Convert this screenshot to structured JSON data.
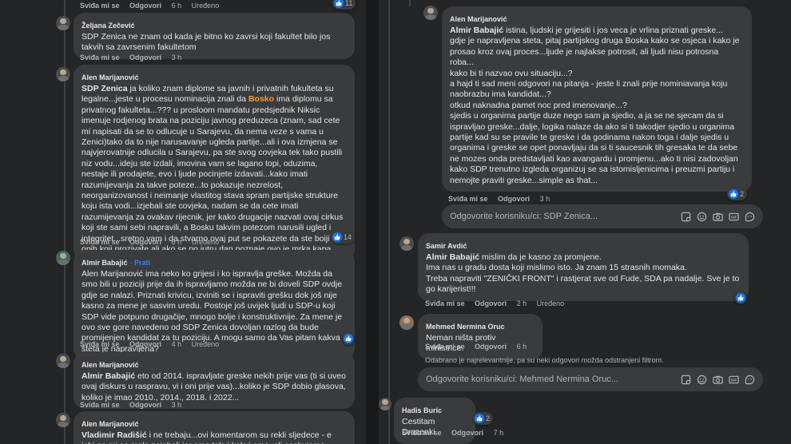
{
  "left": {
    "top_actions": {
      "like": "Sviđa mi se",
      "reply": "Odgovori",
      "time": "6 h",
      "edited": "Uređeno",
      "reactions": "11"
    },
    "comments": [
      {
        "author": "Željana Zečević",
        "text": "SDP Zenica ne znam od kada je bitno ko zavrsi koji fakultet bilo jos takvih sa zavrsenim fakultetom",
        "like": "Sviđa mi se",
        "reply": "Odgovori",
        "time": "3 h"
      },
      {
        "author": "Alen Marijanović",
        "mention": "SDP Zenica",
        "text_a": " ja koliko znam diplome sa javnih i privatnih fukulteta su legalne...jeste u procesu nominacija znali da ",
        "highlight": "Bosko",
        "text_b": " ima diplomu sa privatnog fakulteta...??? u prosloom mandatu predsjednik Niksic imenuje rodjenog brata na poziciju javnog preduzeca (znam, sad cete mi napisati da se to odlucuje u Sarajevu, da nema veze s vama u Zenici)tako da to nije narusavanje ugleda partije...ali i ova izmjena se najvjerovatnije odlucila u Sarajevu, pa ste svog covjeka tek tako pustili niz vodu...ideju ste izdali, imovina vam se lagano topi, oduzima, nestaje ili prodajete, evo i ljude pocinjete izdavati...kako imati razumijevanja za takve poteze...to pokazuje nezrelost, neorganizovanost i neimanje vlastitog stava spram partijske strukture koju ista vodi...izjebali ste covjeka, nadam se da cete imati razumijevanja za ovakav rijecnik, jer kako drugacije nazvati ovaj cirkus koji ste sami sebi napravili, a Bosku takvim potezom narusili ugled i integritet...sretno vam i da stvarno ovaj put se pokazete da ste boiji od onih koji prozivate ali ako se po jutru dan poznaje ovo je mrka kapa...",
        "like": "Sviđa mi se",
        "reply": "Odgovori",
        "time": "6 h",
        "edited": "Uređeno",
        "reactions": "14"
      },
      {
        "author": "Almir Babajić",
        "follow": "· Prati",
        "text": "Alen Marijanović ima neko ko grijesi i ko ispravlja greške. Možda da smo bili u poziciji prije da ih ispravljamo možda ne bi doveli SDP ovdje gdje se nalazi. Priznati krivicu, izviniti se i ispraviti grešku dok još nije kasno za mene je sasvim uredu. Postoje još uvijek ljudi u SDP-u koji SDP vide potpuno drugačije, mnogo bolje i konstruktivnije. Za mene je ovo sve gore navedeno od SDP Zenica dovoljan razlog da bude promijenjen kandidat za tu poziciju. A mogu samo da Vas pitam kakva šteta je napravljena?",
        "like": "Sviđa mi se",
        "reply": "Odgovori",
        "time": "4 h",
        "edited": "Uređeno"
      },
      {
        "author": "Alen Marijanović",
        "mention": "Almir Babajić",
        "text": " eto od 2014. ispravljate greske nekih prije vas (ti si uveo ovaj diskurs u raspravu, vi i oni prije vas)...koliko je SDP dobio glasova, koliko je imao 2010., 2014., 2018. i 2022...",
        "like": "Sviđa mi se",
        "reply": "Odgovori",
        "time": "3 h"
      },
      {
        "author": "Alen Marijanović",
        "mention": "Vladimir Radišić",
        "text": " i ne trebaju...ovi komentarom su rekli sljedece - e jebi ga mi se malo zajebali jer smo takvi kakvi smo, ali ocekujemo razumijevanje javnosti"
      }
    ]
  },
  "right": {
    "comments": [
      {
        "author": "Alen Marijanović",
        "mention": "Almir Babajić",
        "text": " istina, ljudski je grijesiti i jos veca je vrlina priznati greske...\ngdje je napravljena steta, pitaj partijskog druga Boska kako se osjeca i kako je prosao kroz ovaj proces...ljude je najlakse potrosit, ali ljudi nisu potrosna roba...\nkako bi ti nazvao ovu situaciju...?\na hajd ti sad meni odgovori na pitanja - jeste li znali prije nominiavanja koju naobrazbu ima kandidat...?\notkud naknadna pamet noc pred imenovanje...?\nsjedis u organima partije duze nego sam ja sjedio, a ja se ne sjecam da si ispravljao greske...dalje, logika nalaze da ako si ti takodjer sjedio u organima partije kad su se pravile te greske i da godinama nakon toga i dalje sjedis u organima i greske se opet ponavljaju da si ti saucesnik tih gresaka te da sebe ne mozes onda predstavljati kao avangardu i promjenu...ako ti nisi zadovoljan kako SDP trenutno izgleda organizuj se sa istomisljenicima i preuzmi partiju i nemojte praviti greske...simple as that...",
        "like": "Sviđa mi se",
        "reply": "Odgovori",
        "time": "3 h",
        "reactions": "2"
      },
      {
        "author": "Samir Avdić",
        "mention": "Almir Babajić",
        "text": " mislim da je kasno za promjene.\nIma nas u gradu dosta koji mislimo isto. Ja znam 15 strasnih momaka.\nTreba napraviti \"ZENIČKI FRONT\" i rastjerat sve od Fude, SDA pa nadalje. Sve je to go karijerist!!!",
        "like": "Sviđa mi se",
        "reply": "Odgovori",
        "time": "2 h",
        "edited": "Uređeno"
      },
      {
        "author": "Mehmed Nermina Oruc",
        "text": "Neman ništa protiv ministrice.",
        "like": "Sviđa mi se",
        "reply": "Odgovori",
        "time": "6 h"
      },
      {
        "author": "Hadis Buric",
        "text": "Cestitam Drazenki",
        "like": "Sviđa mi se",
        "reply": "Odgovori",
        "time": "7 h",
        "reactions": "2"
      }
    ],
    "reply_box_1": {
      "placeholder": "Odgovorite korisniku/ci: SDP Zenica..."
    },
    "reply_box_2": {
      "placeholder": "Odgovorite korisniku/ci: Mehmed Nermina Oruc..."
    },
    "filter_note": "Odabrano je najrelevantnije, pa su neki odgovori možda odstranjeni filtrom."
  },
  "colors": {
    "background": "#18191a",
    "panel": "#242526",
    "bubble": "#3a3b3c",
    "text": "#e4e6eb",
    "muted": "#b0b3b8",
    "link": "#2d88ff",
    "like": "#1877f2",
    "highlight": "#ff9a2a"
  }
}
